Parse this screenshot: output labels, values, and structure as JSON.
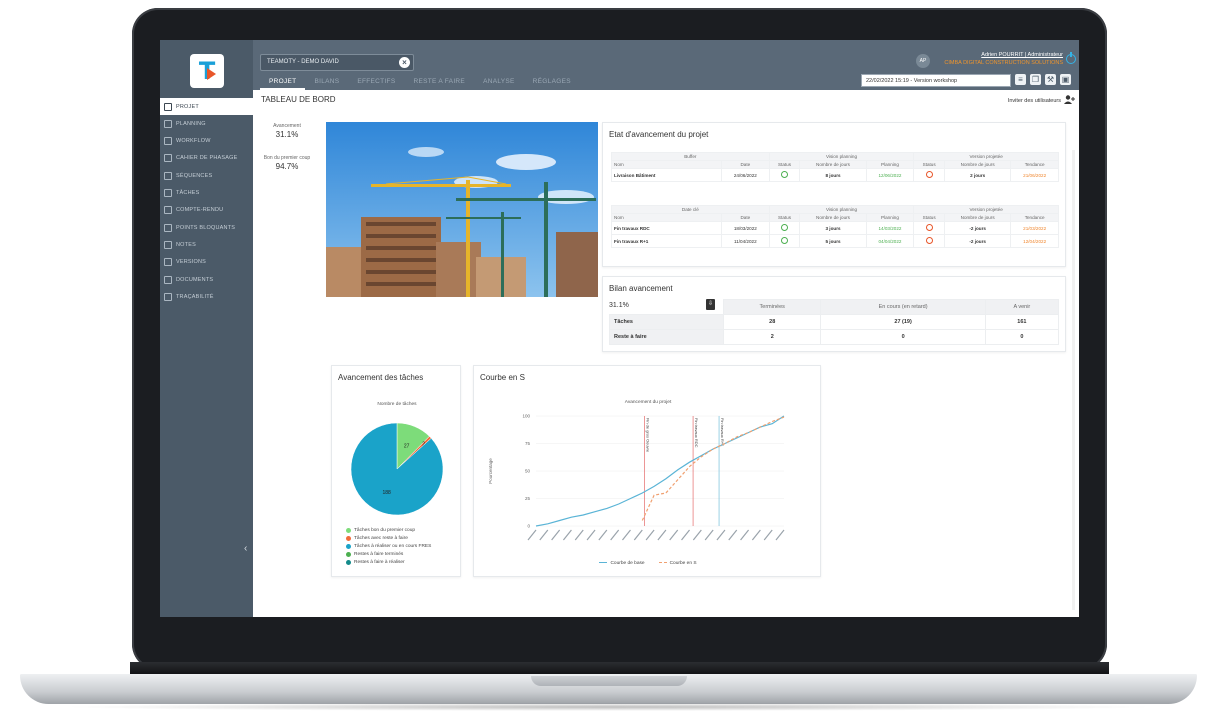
{
  "app": {
    "project_tab": "TEAMOTY - DEMO DAVID",
    "tab_close_icon": "close-icon",
    "nav": [
      {
        "label": "PROJET",
        "active": true
      },
      {
        "label": "BILANS",
        "active": false
      },
      {
        "label": "EFFECTIFS",
        "active": false
      },
      {
        "label": "RESTE A FAIRE",
        "active": false
      },
      {
        "label": "ANALYSE",
        "active": false
      },
      {
        "label": "RÉGLAGES",
        "active": false
      }
    ],
    "version": "22/02/2022 15:19 - Version workshop",
    "user": {
      "initials": "AP",
      "name_role": "Adrien POURRIT | Administrateur",
      "company": "CIMBA DIGITAL CONSTRUCTION SOLUTIONS"
    }
  },
  "sidebar": {
    "items": [
      {
        "label": "PROJET",
        "icon": "project-icon",
        "active": true
      },
      {
        "label": "PLANNING",
        "icon": "planning-icon"
      },
      {
        "label": "WORKFLOW",
        "icon": "workflow-icon"
      },
      {
        "label": "CAHIER DE PHASAGE",
        "icon": "phasing-icon"
      },
      {
        "label": "SÉQUENCES",
        "icon": "sequences-icon"
      },
      {
        "label": "TÂCHES",
        "icon": "tasks-icon"
      },
      {
        "label": "COMPTE-RENDU",
        "icon": "report-icon"
      },
      {
        "label": "POINTS BLOQUANTS",
        "icon": "blocking-points-icon"
      },
      {
        "label": "NOTES",
        "icon": "notes-icon"
      },
      {
        "label": "VERSIONS",
        "icon": "versions-icon"
      },
      {
        "label": "DOCUMENTS",
        "icon": "documents-icon"
      },
      {
        "label": "TRAÇABILITÉ",
        "icon": "traceability-icon"
      }
    ]
  },
  "page": {
    "title": "TABLEAU DE BORD",
    "invite": "Inviter des utilisateurs"
  },
  "kpis": [
    {
      "label": "Avancement",
      "value": "31.1%"
    },
    {
      "label": "Bon du premier coup",
      "value": "94.7%"
    }
  ],
  "etat": {
    "title": "Etat d'avancement du projet",
    "table1": {
      "group_left": "Buffer",
      "group_mid": "Vision planning",
      "group_right": "Version projetée",
      "headers": [
        "Nom",
        "Date",
        "Status",
        "Nombre de jours",
        "Planning",
        "Status",
        "Nombre de jours",
        "Tendance"
      ],
      "rows": [
        {
          "nom": "Livraison Bâtiment",
          "date": "24/06/2022",
          "nb1": "8 jours",
          "planning": "12/06/2022",
          "nb2": "2 jours",
          "tendance": "21/06/2022"
        }
      ]
    },
    "table2": {
      "group_left": "Date clé",
      "group_mid": "Vision planning",
      "group_right": "Version projetée",
      "headers": [
        "Nom",
        "Date",
        "Status",
        "Nombre de jours",
        "Planning",
        "Status",
        "Nombre de jours",
        "Tendance"
      ],
      "rows": [
        {
          "nom": "Fin travaux RDC",
          "date": "18/03/2022",
          "nb1": "3 jours",
          "planning": "14/03/2022",
          "nb2": "-2 jours",
          "tendance": "21/03/2022"
        },
        {
          "nom": "Fin travaux R+1",
          "date": "11/04/2022",
          "nb1": "5 jours",
          "planning": "04/04/2022",
          "nb2": "-2 jours",
          "tendance": "12/04/2022"
        }
      ]
    }
  },
  "bilan": {
    "title": "Bilan avancement",
    "percent": "31.1%",
    "headers": [
      "Terminées",
      "En cours (en retard)",
      "A venir"
    ],
    "rows": [
      {
        "label": "Tâches",
        "values": [
          "28",
          "27 (19)",
          "161"
        ]
      },
      {
        "label": "Reste à faire",
        "values": [
          "2",
          "0",
          "0"
        ]
      }
    ]
  },
  "pie_card": {
    "title": "Avancement des tâches",
    "chart_title": "Nombre de tâches",
    "labels": [
      "27",
      "2",
      "188"
    ],
    "legend": [
      {
        "label": "Tâches bon du premier coup",
        "color": "#7ddc7a"
      },
      {
        "label": "Tâches avec reste à faire",
        "color": "#f26b3a"
      },
      {
        "label": "Tâches à réaliser ou en cours FRES",
        "color": "#1aa3c9"
      },
      {
        "label": "Restes à faire terminés",
        "color": "#4caf50"
      },
      {
        "label": "Restes à faire à réaliser",
        "color": "#138a8a"
      }
    ]
  },
  "curve_card": {
    "title": "Courbe en S",
    "chart_title": "Avancement du projet",
    "ylabel": "Pourcentage",
    "yticks": [
      "0",
      "25",
      "50",
      "75",
      "100"
    ],
    "marker_labels": [
      "Fin de gros Oeuvre",
      "Fin travaux RDC",
      "Fin travaux R+1"
    ],
    "legend": [
      "Courbe de base",
      "Courbe en S"
    ]
  },
  "chart_data": [
    {
      "type": "pie",
      "title": "Nombre de tâches",
      "categories": [
        "Tâches bon du premier coup",
        "Tâches avec reste à faire",
        "Tâches à réaliser ou en cours FRES"
      ],
      "values": [
        27,
        2,
        188
      ],
      "colors": [
        "#7ddc7a",
        "#f26b3a",
        "#1aa3c9"
      ]
    },
    {
      "type": "line",
      "title": "Avancement du projet",
      "ylabel": "Pourcentage",
      "ylim": [
        0,
        100
      ],
      "x_count": 22,
      "series": [
        {
          "name": "Courbe de base",
          "color": "#5ab4d6",
          "values": [
            0,
            2,
            5,
            8,
            10,
            13,
            16,
            20,
            25,
            30,
            36,
            43,
            51,
            58,
            64,
            70,
            75,
            80,
            85,
            90,
            93,
            100
          ]
        },
        {
          "name": "Courbe en S",
          "color": "#f0a070",
          "dashed": true,
          "values": [
            null,
            null,
            null,
            null,
            null,
            null,
            null,
            null,
            null,
            5,
            28,
            30,
            42,
            54,
            63,
            70,
            75,
            81,
            85,
            90,
            95,
            99
          ]
        }
      ],
      "vertical_markers": [
        {
          "label": "Fin de gros Oeuvre",
          "x_index": 9.2,
          "color": "#e05050"
        },
        {
          "label": "Fin travaux RDC",
          "x_index": 13.3,
          "color": "#e05050"
        },
        {
          "label": "Fin travaux R+1",
          "x_index": 15.5,
          "color": "#5ab4d6"
        }
      ]
    }
  ]
}
